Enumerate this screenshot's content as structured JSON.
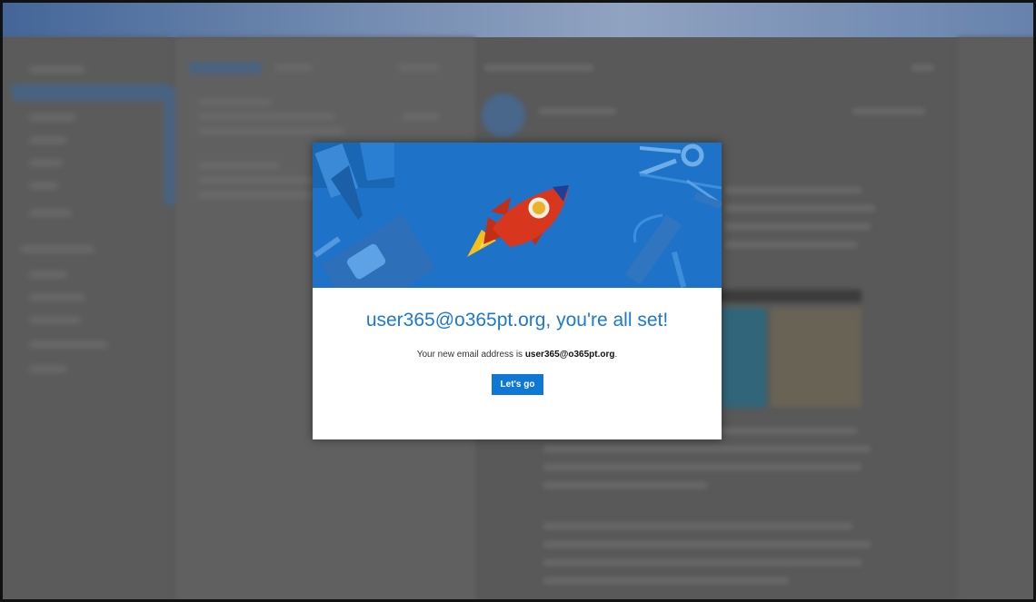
{
  "dialog": {
    "title": "user365@o365pt.org, you're all set!",
    "subtitle_prefix": "Your new email address is ",
    "email": "user365@o365pt.org",
    "subtitle_suffix": ".",
    "button_label": "Let's go"
  },
  "colors": {
    "accent": "#0f78d4",
    "title": "#1b79d2",
    "hero_bg": "#1e73c9",
    "rocket_body": "#d8371e",
    "rocket_nose": "#1d3f9b",
    "flame": "#f6c01a"
  },
  "icons": [
    "rocket-illustration",
    "scissors-icon",
    "pencil-icon",
    "notebook-icon"
  ]
}
